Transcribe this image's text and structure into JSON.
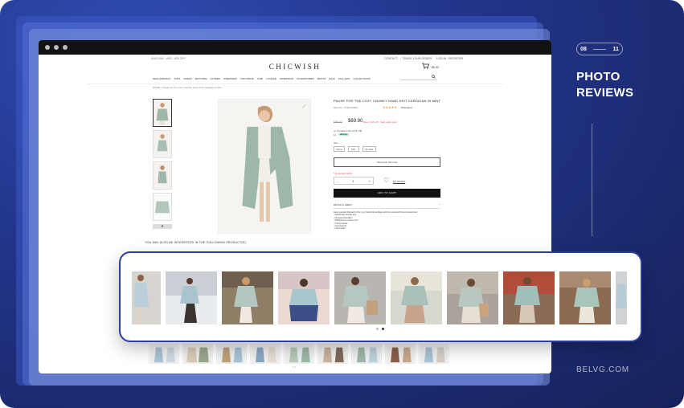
{
  "slide": {
    "pager_current": "08",
    "pager_total": "11",
    "heading_line1": "PHOTO",
    "heading_line2": "REVIEWS",
    "brand": "BELVG.COM"
  },
  "store": {
    "top_left": "ENGLISH · USD · $20 OFF",
    "top_right": [
      "CONTACT",
      "TRACK YOUR ORDER",
      "LOG IN · REGISTER"
    ],
    "logo": "CHICWISH",
    "cart_count": "0",
    "cart_amount": "$0.00",
    "menu": [
      "NEW ARRIVALS",
      "TOPS",
      "DRESS",
      "BOTTOMS",
      "OUTERS",
      "SWEATERS",
      "TWO-PIECE",
      "CAMI",
      "LOUNGE",
      "SWIMWEAR",
      "ACCESSORIES",
      "BOOTS",
      "SALE",
      "FALL EDIT",
      "COLLECTIONS"
    ],
    "breadcrumb": "HOME > Pause for the Cozy Chunky Hand Knit Cardigan in Mint",
    "product": {
      "title": "PAUSE FOR THE COZY CHUNKY HAND KNIT CARDIGAN IN MINT",
      "item_no": "Item No.: T190731003",
      "stars": "★★★★★",
      "reviews": "8 Reviews",
      "old_price": "$88.90",
      "price": "$69.90",
      "save": "Save: 21% off · Sale ends soon",
      "installments": "or 4 installments of $17.48",
      "by": "by",
      "afterpay": "afterpay",
      "size_label": "Size",
      "sizes": [
        "XS-S",
        "M-L",
        "XL-XXL"
      ],
      "size_guide": "Find your size now",
      "required": "* Required Fields",
      "qty": "1",
      "qty_minus": "-",
      "qty_plus": "+",
      "wishlist": "My Wishlist",
      "add_to_cart": "ADD TO CART",
      "details_label": "DETAIL & SIZES",
      "details_toggle": "^",
      "description": [
        "Have yourself dressed in this cozy hand-knit cardigan with its oversized fit and relaxed feel.",
        "- Handmade chunky knit",
        "- Dropped shoulders",
        "- Ribbed trims, button front",
        "- Front pockets",
        "- Oversized fit",
        "- Hand wash"
      ]
    },
    "also_like": "YOU MAY ALSO BE INTERESTED IN THE FOLLOWING PRODUCT(S)",
    "carousel_dots": "• •"
  },
  "colors": {
    "accent": "#2a3f9e",
    "mint": "#9db8a8",
    "price_red": "#e05050"
  }
}
